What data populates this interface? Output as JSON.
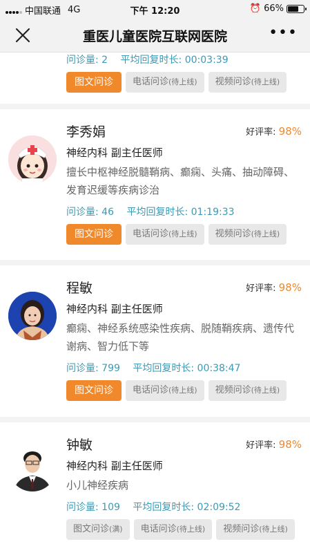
{
  "status_bar": {
    "carrier": "中国联通",
    "network": "4G",
    "time": "下午 12:20",
    "battery": "66%",
    "battery_level": 0.66
  },
  "nav": {
    "title": "重医儿童医院互联网医院",
    "more": "•••"
  },
  "labels": {
    "rating": "好评率:",
    "consults": "问诊量:",
    "avg_reply": "平均回复时长:"
  },
  "doctors": [
    {
      "consults": "2",
      "avg_reply": "00:03:39",
      "buttons": [
        {
          "label": "图文问诊",
          "note": ""
        },
        {
          "label": "电话问诊",
          "note": "(待上线)"
        },
        {
          "label": "视频问诊",
          "note": "(待上线)"
        }
      ]
    },
    {
      "name": "李秀娟",
      "rating": "98%",
      "dept": "神经内科  副主任医师",
      "specialty": "擅长中枢神经脱髓鞘病、癫痫、头痛、抽动障碍、发育迟缓等疾病诊治",
      "consults": "46",
      "avg_reply": "01:19:33",
      "avatar": "cartoon-nurse-avatar",
      "buttons": [
        {
          "label": "图文问诊",
          "note": ""
        },
        {
          "label": "电话问诊",
          "note": "(待上线)"
        },
        {
          "label": "视频问诊",
          "note": "(待上线)"
        }
      ]
    },
    {
      "name": "程敏",
      "rating": "98%",
      "dept": "神经内科  副主任医师",
      "specialty": "癫痫、神经系统感染性疾病、脱随鞘疾病、遗传代谢病、智力低下等",
      "consults": "799",
      "avg_reply": "00:38:47",
      "avatar": "female-doctor-photo",
      "buttons": [
        {
          "label": "图文问诊",
          "note": ""
        },
        {
          "label": "电话问诊",
          "note": "(待上线)"
        },
        {
          "label": "视频问诊",
          "note": "(待上线)"
        }
      ]
    },
    {
      "name": "钟敏",
      "rating": "98%",
      "dept": "神经内科  副主任医师",
      "specialty": "小儿神经疾病",
      "consults": "109",
      "avg_reply": "02:09:52",
      "avatar": "male-doctor-photo",
      "buttons": [
        {
          "label": "图文问诊",
          "note": "(满)"
        },
        {
          "label": "电话问诊",
          "note": "(待上线)"
        },
        {
          "label": "视频问诊",
          "note": "(待上线)"
        }
      ]
    }
  ],
  "colors": {
    "accent": "#f0892c",
    "stats": "#3a9ab5",
    "button_gray": "#e8e8e8"
  }
}
